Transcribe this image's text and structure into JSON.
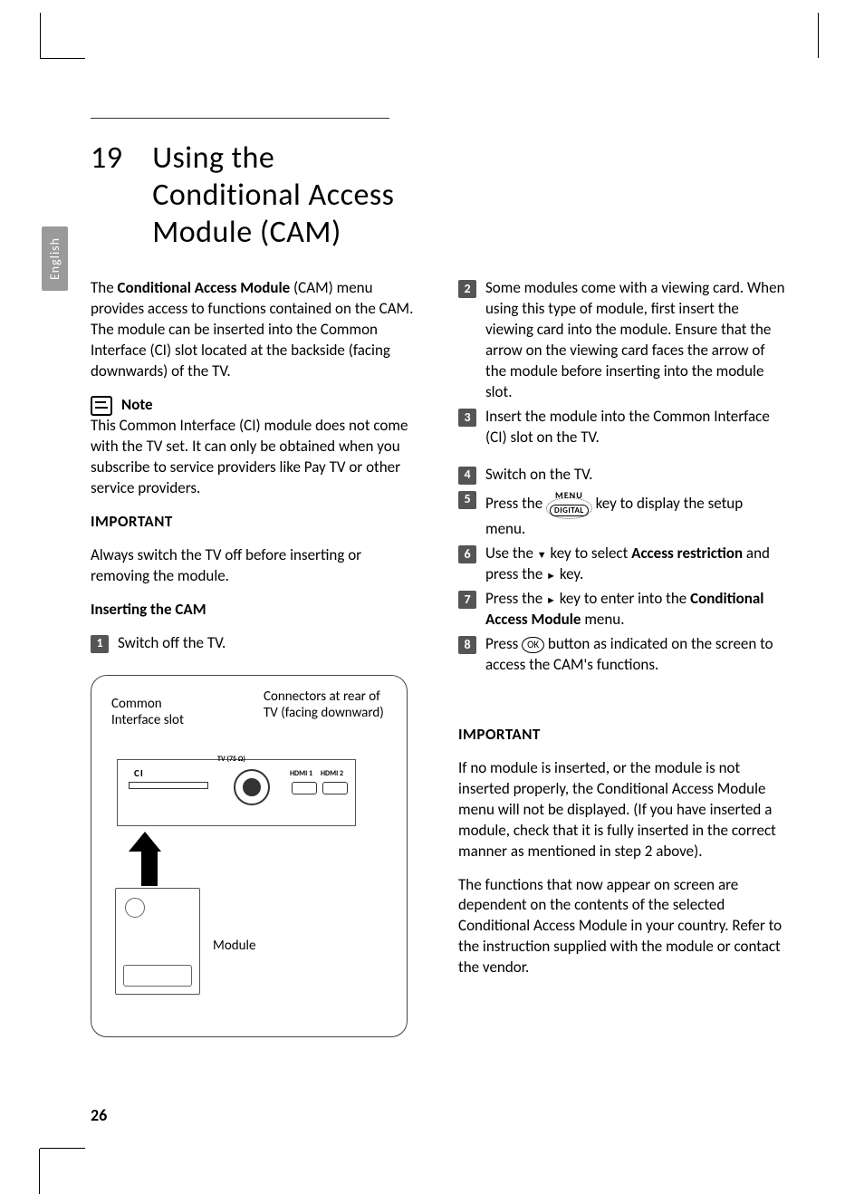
{
  "sideTab": "English",
  "chapter": {
    "num": "19",
    "title": "Using the Conditional Access Module (CAM)"
  },
  "left": {
    "intro_pre": "The ",
    "intro_bold": "Conditional Access Module",
    "intro_post": " (CAM) menu provides access to functions contained on the CAM.  The module can be inserted into the Common Interface (CI) slot located at the backside (facing downwards) of the TV.",
    "note_label": "Note",
    "note_text": "This Common Interface (CI) module does not come with the TV set. It  can only be obtained when you subscribe to service providers like Pay TV or other service providers.",
    "important": "IMPORTANT",
    "important_text": "Always switch the TV off before inserting or removing the module.",
    "inserting": "Inserting the CAM",
    "step1": "Switch off the TV.",
    "diagram": {
      "ci": "Common Interface slot",
      "conn": "Connectors at rear of TV (facing downward)",
      "ci_small": "CI",
      "coax": "TV (75 Ω)",
      "hdmi1": "HDMI 1",
      "hdmi2": "HDMI 2",
      "module": "Module"
    }
  },
  "right": {
    "step2": "Some modules come with a viewing card. When using this type of module, first insert the viewing card into the module. Ensure that the arrow on the viewing card faces the arrow of the module before inserting into the module slot.",
    "step3": "Insert the module into the Common Interface (CI) slot on the TV.",
    "step4": "Switch on the TV.",
    "menu_label": "MENU",
    "digital": "DIGITAL",
    "step5_a": "Press the  ",
    "step5_b": "  key to display the setup menu.",
    "step6_a": "Use the ",
    "step6_b": " key to select ",
    "step6_bold": "Access restriction",
    "step6_c": " and press the ",
    "step6_d": " key.",
    "step7_a": "Press the ",
    "step7_b": " key to enter into the ",
    "step7_bold": "Conditional Access Module",
    "step7_c": " menu.",
    "step8_a": "Press ",
    "ok": "OK",
    "step8_b": " button as indicated on the screen to access the CAM's functions.",
    "important": "IMPORTANT",
    "important_text": "If no module is inserted, or the module is not inserted properly, the Conditional Access Module menu will not be displayed. (If you have inserted a module, check that it is fully inserted in the correct manner as mentioned in step 2 above).",
    "final": "The functions that now appear on screen are dependent on the contents of the selected Conditional Access Module in your country. Refer to the instruction supplied with the module or contact the vendor."
  },
  "pageNumber": "26"
}
